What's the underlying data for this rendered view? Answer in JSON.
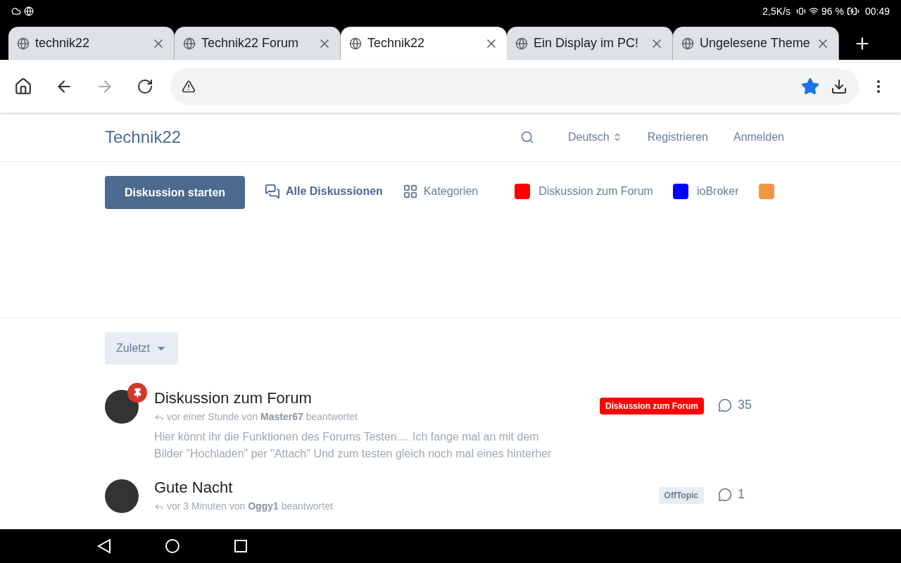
{
  "status_bar": {
    "speed": "2,5K/s",
    "battery": "96 %",
    "time": "00:49"
  },
  "tabs": [
    {
      "title": "technik22",
      "selected": false
    },
    {
      "title": "Technik22 Forum",
      "selected": false
    },
    {
      "title": "Technik22",
      "selected": true
    },
    {
      "title": "Ein Display im PC!",
      "selected": false
    },
    {
      "title": "Ungelesene Theme",
      "selected": false
    }
  ],
  "toolbar": {
    "bookmarked": true
  },
  "site": {
    "title": "Technik22",
    "language": "Deutsch",
    "register": "Registrieren",
    "login": "Anmelden"
  },
  "nav": {
    "start_button": "Diskussion starten",
    "all": "Alle Diskussionen",
    "categories": "Kategorien"
  },
  "tags": [
    {
      "label": "Diskussion zum Forum",
      "color": "#ff0000"
    },
    {
      "label": "ioBroker",
      "color": "#0000ff"
    },
    {
      "color": "#f39642"
    }
  ],
  "sort": "Zuletzt",
  "discussions": [
    {
      "title": "Diskussion zum Forum",
      "pinned": true,
      "meta_prefix": "vor einer Stunde von",
      "author": "Master67",
      "meta_suffix": "beantwortet",
      "excerpt": "Hier könnt ihr die Funktionen des Forums Testen.... Ich fange mal an mit dem Bilder \"Hochladen\" per \"Attach\" Und zum testen gleich noch mal eines hinterher",
      "tag": {
        "label": "Diskussion zum Forum",
        "color": "#ff0000"
      },
      "replies": "35"
    },
    {
      "title": "Gute Nacht",
      "pinned": false,
      "meta_prefix": "vor 3 Minuten von",
      "author": "Oggy1",
      "meta_suffix": "beantwortet",
      "tag": {
        "label": "OffTopic",
        "color": "#e8ecf3"
      },
      "replies": "1"
    }
  ]
}
